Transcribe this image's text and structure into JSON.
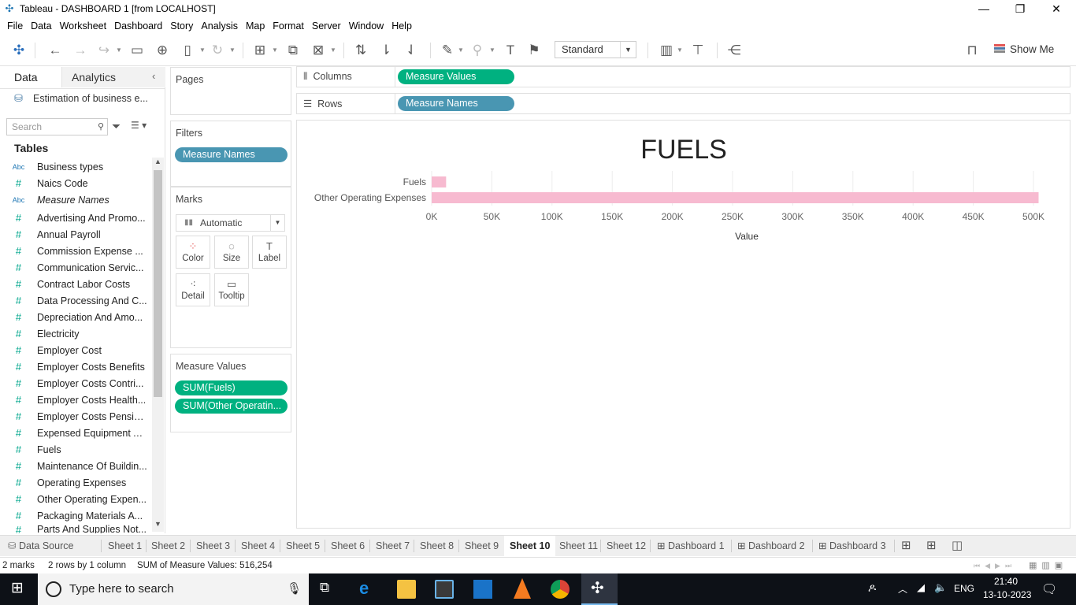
{
  "window": {
    "title": "Tableau - DASHBOARD 1 [from LOCALHOST]"
  },
  "menu": [
    "File",
    "Data",
    "Worksheet",
    "Dashboard",
    "Story",
    "Analysis",
    "Map",
    "Format",
    "Server",
    "Window",
    "Help"
  ],
  "toolbar": {
    "fit": "Standard",
    "show_me": "Show Me"
  },
  "data_pane": {
    "tabs": [
      "Data",
      "Analytics"
    ],
    "datasource": "Estimation of business e...",
    "search_placeholder": "Search",
    "tables_heading": "Tables",
    "fields": [
      {
        "type": "Abc",
        "name": "Business types"
      },
      {
        "type": "#",
        "name": "Naics Code"
      },
      {
        "type": "Abc",
        "name": "Measure Names"
      },
      {
        "type": "#",
        "name": "Advertising And Promo..."
      },
      {
        "type": "#",
        "name": "Annual Payroll"
      },
      {
        "type": "#",
        "name": "Commission Expense ..."
      },
      {
        "type": "#",
        "name": "Communication Servic..."
      },
      {
        "type": "#",
        "name": "Contract Labor Costs"
      },
      {
        "type": "#",
        "name": "Data Processing And C..."
      },
      {
        "type": "#",
        "name": "Depreciation And Amo..."
      },
      {
        "type": "#",
        "name": "Electricity"
      },
      {
        "type": "#",
        "name": "Employer Cost"
      },
      {
        "type": "#",
        "name": "Employer Costs Benefits"
      },
      {
        "type": "#",
        "name": "Employer Costs Contri..."
      },
      {
        "type": "#",
        "name": "Employer Costs Health..."
      },
      {
        "type": "#",
        "name": "Employer Costs Pensio..."
      },
      {
        "type": "#",
        "name": "Expensed Equipment A..."
      },
      {
        "type": "#",
        "name": "Fuels"
      },
      {
        "type": "#",
        "name": "Maintenance Of Buildin..."
      },
      {
        "type": "#",
        "name": "Operating Expenses"
      },
      {
        "type": "#",
        "name": "Other Operating Expen..."
      },
      {
        "type": "#",
        "name": "Packaging Materials A..."
      },
      {
        "type": "#",
        "name": "Parts And Supplies Not..."
      }
    ]
  },
  "cards": {
    "pages": "Pages",
    "filters": {
      "title": "Filters",
      "pill": "Measure Names"
    },
    "marks": {
      "title": "Marks",
      "type": "Automatic",
      "buttons": [
        "Color",
        "Size",
        "Label",
        "Detail",
        "Tooltip"
      ]
    },
    "measure_values": {
      "title": "Measure Values",
      "pills": [
        "SUM(Fuels)",
        "SUM(Other Operatin..."
      ]
    }
  },
  "shelves": {
    "columns": {
      "label": "Columns",
      "pill": "Measure Values"
    },
    "rows": {
      "label": "Rows",
      "pill": "Measure Names"
    }
  },
  "chart_data": {
    "type": "bar",
    "orientation": "horizontal",
    "title": "FUELS",
    "categories": [
      "Fuels",
      "Other Operating Expenses"
    ],
    "values": [
      12000,
      504254
    ],
    "xlabel": "Value",
    "ylabel": "",
    "xlim": [
      0,
      500000
    ],
    "x_ticks": [
      "0K",
      "50K",
      "100K",
      "150K",
      "200K",
      "250K",
      "300K",
      "350K",
      "400K",
      "450K",
      "500K"
    ],
    "grid": "vertical",
    "color": "#f7bad0"
  },
  "sheet_tabs": {
    "datasource": "Data Source",
    "sheets": [
      "Sheet 1",
      "Sheet 2",
      "Sheet 3",
      "Sheet 4",
      "Sheet 5",
      "Sheet 6",
      "Sheet 7",
      "Sheet 8",
      "Sheet 9",
      "Sheet 10",
      "Sheet 11",
      "Sheet 12"
    ],
    "active": "Sheet 10",
    "dashboards": [
      "Dashboard 1",
      "Dashboard 2",
      "Dashboard 3"
    ]
  },
  "status": {
    "marks": "2 marks",
    "dims": "2 rows by 1 column",
    "sum": "SUM of Measure Values: 516,254"
  },
  "taskbar": {
    "search_placeholder": "Type here to search",
    "lang": "ENG",
    "time": "21:40",
    "date": "13-10-2023"
  }
}
